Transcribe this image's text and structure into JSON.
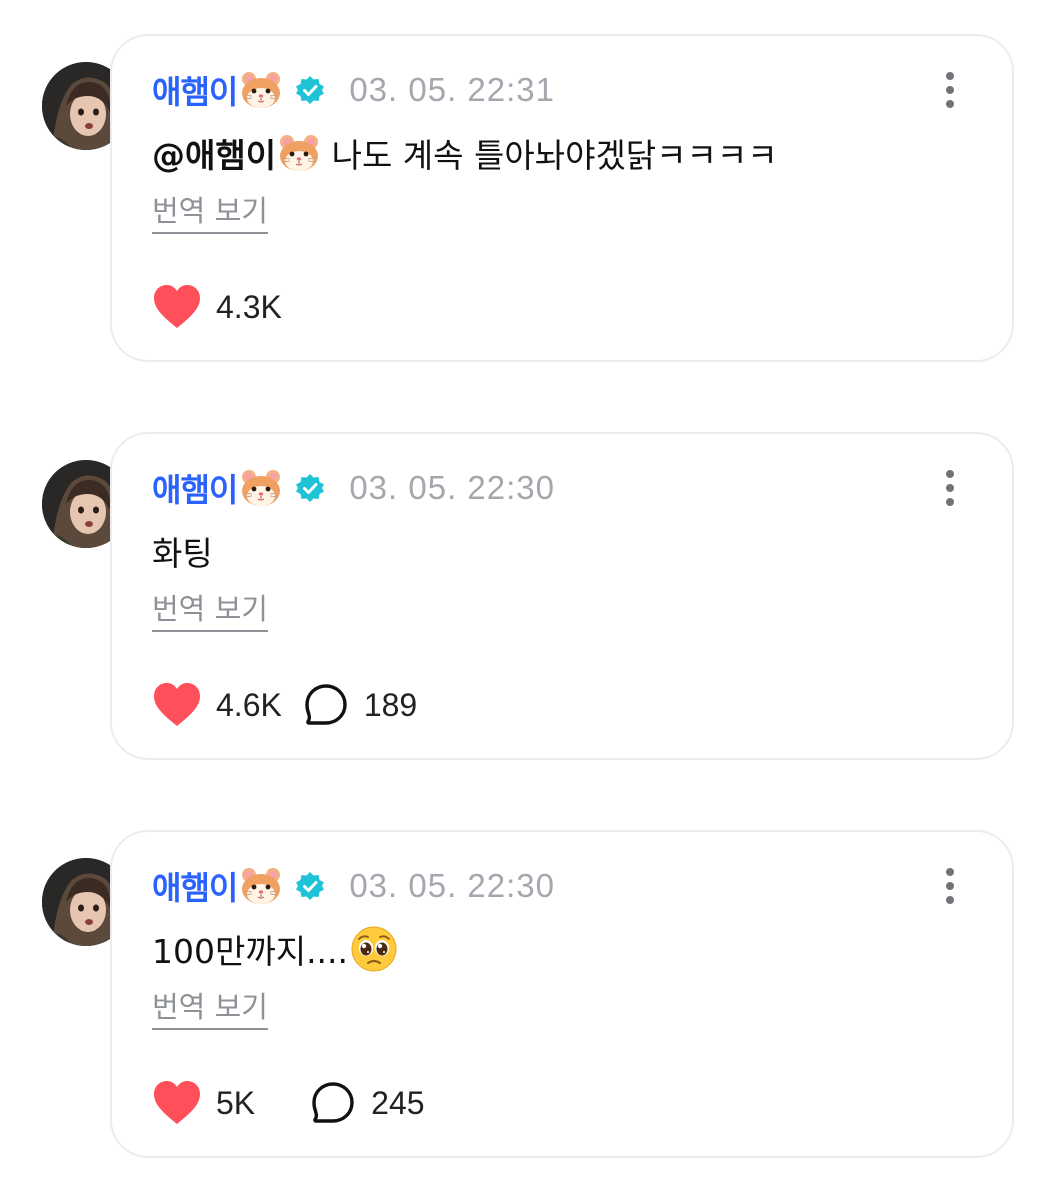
{
  "posts": [
    {
      "author": "애햄이",
      "author_emoji": "hamster-emoji",
      "verified_icon": "verified-badge-icon",
      "timestamp": "03. 05. 22:31",
      "mention": "@애햄이",
      "text": " 나도 계속 틀아놔야겠닭ㅋㅋㅋㅋ",
      "translate_label": "번역 보기",
      "likes": "4.3K",
      "comments": null
    },
    {
      "author": "애햄이",
      "author_emoji": "hamster-emoji",
      "verified_icon": "verified-badge-icon",
      "timestamp": "03. 05. 22:30",
      "mention": null,
      "text": "화팅",
      "translate_label": "번역 보기",
      "likes": "4.6K",
      "comments": "189"
    },
    {
      "author": "애햄이",
      "author_emoji": "hamster-emoji",
      "verified_icon": "verified-badge-icon",
      "timestamp": "03. 05. 22:30",
      "mention": null,
      "text": "100만까지....",
      "text_emoji": "pleading-face-emoji",
      "translate_label": "번역 보기",
      "likes": "5K",
      "comments": "245"
    }
  ],
  "colors": {
    "author": "#2962ff",
    "verified": "#1fc3d6",
    "heart": "#ff4f5a",
    "timestamp": "#a4a7ad",
    "card_border": "#ececf0"
  }
}
